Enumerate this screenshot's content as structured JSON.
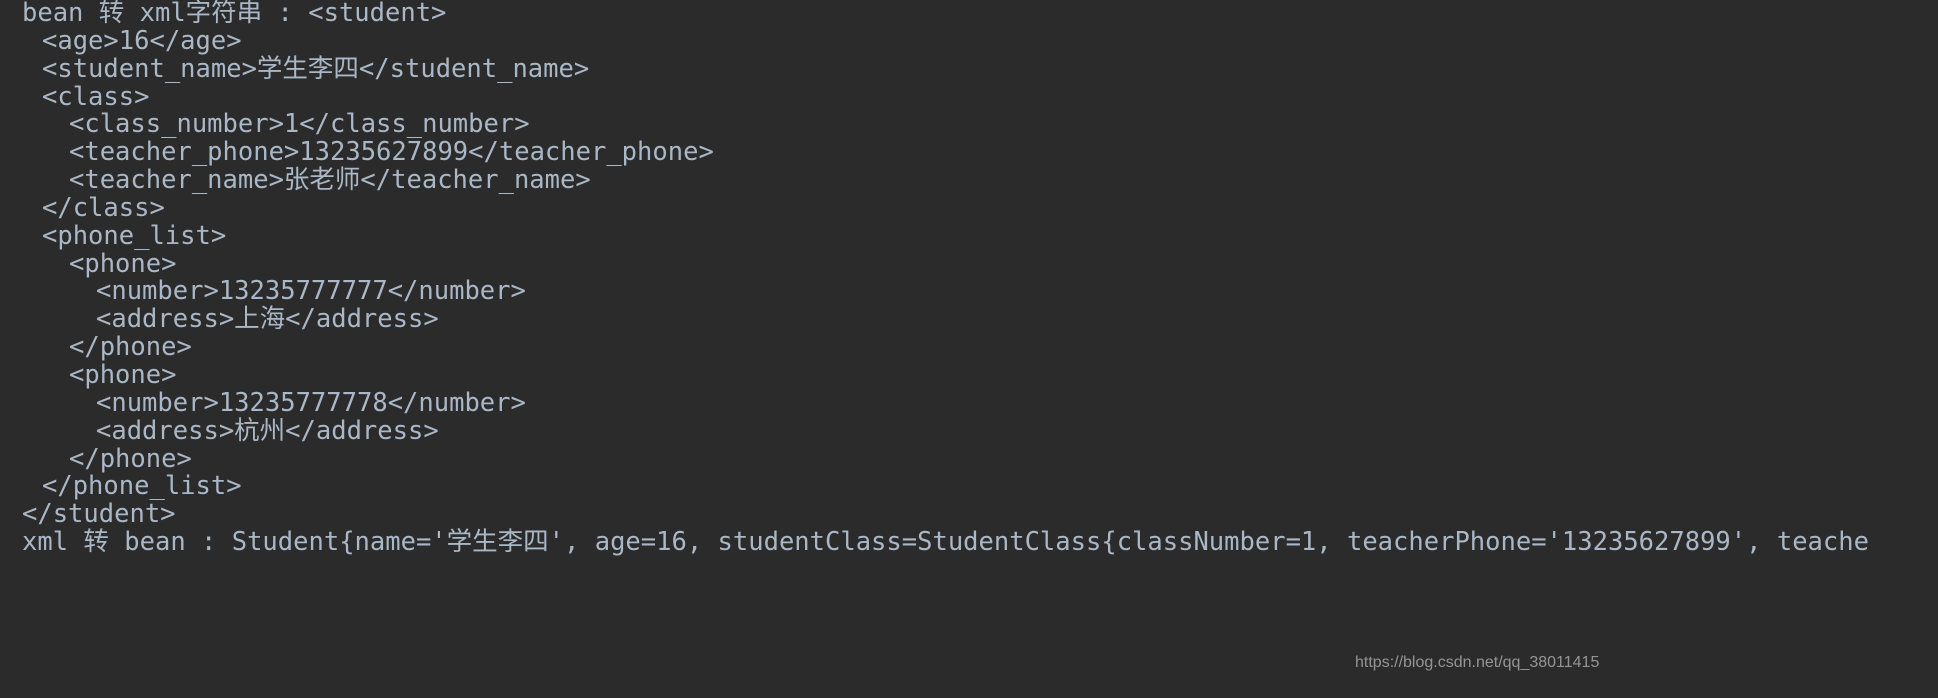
{
  "console": {
    "background_color": "#2b2b2b",
    "text_color": "#a9b7c6",
    "lines": [
      {
        "indent": 0,
        "text": "bean 转 xml字符串 : <student>"
      },
      {
        "indent": 1,
        "text": "<age>16</age>"
      },
      {
        "indent": 1,
        "text": "<student_name>学生李四</student_name>"
      },
      {
        "indent": 1,
        "text": "<class>"
      },
      {
        "indent": 2,
        "text": "<class_number>1</class_number>"
      },
      {
        "indent": 2,
        "text": "<teacher_phone>13235627899</teacher_phone>"
      },
      {
        "indent": 2,
        "text": "<teacher_name>张老师</teacher_name>"
      },
      {
        "indent": 1,
        "text": "</class>"
      },
      {
        "indent": 1,
        "text": "<phone_list>"
      },
      {
        "indent": 2,
        "text": "<phone>"
      },
      {
        "indent": 3,
        "text": "<number>13235777777</number>"
      },
      {
        "indent": 3,
        "text": "<address>上海</address>"
      },
      {
        "indent": 2,
        "text": "</phone>"
      },
      {
        "indent": 2,
        "text": "<phone>"
      },
      {
        "indent": 3,
        "text": "<number>13235777778</number>"
      },
      {
        "indent": 3,
        "text": "<address>杭州</address>"
      },
      {
        "indent": 2,
        "text": "</phone>"
      },
      {
        "indent": 1,
        "text": "</phone_list>"
      },
      {
        "indent": 0,
        "text": "</student>"
      },
      {
        "indent": 0,
        "text": "xml 转 bean : Student{name='学生李四', age=16, studentClass=StudentClass{classNumber=1, teacherPhone='13235627899', teache"
      }
    ]
  },
  "watermark": {
    "text": "https://blog.csdn.net/qq_38011415"
  }
}
